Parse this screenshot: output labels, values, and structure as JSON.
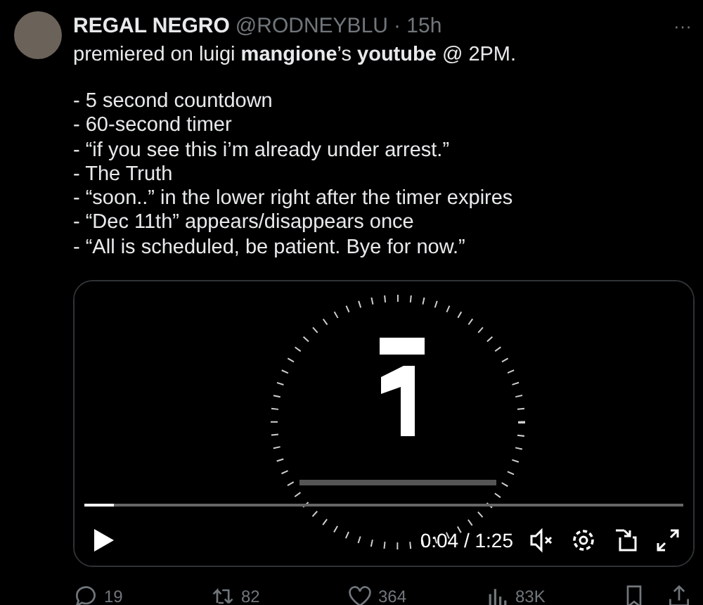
{
  "author": {
    "name": "REGAL NEGRO",
    "handle": "@RODNEYBLU",
    "time": "· 15h",
    "more": "···"
  },
  "text": {
    "lead": "premiered on luigi **mangione**’s **youtube** @ 2PM.",
    "list": [
      "- 5 second countdown",
      "- 60-second timer",
      "- “if you see this i’m already under arrest.”",
      "- The Truth",
      "- “soon..” in the lower right after the timer expires",
      "- “Dec 11th” appears/disappears once",
      "- “All is scheduled, be patient. Bye for now.”"
    ]
  },
  "video": {
    "kind": "picture",
    "progress": {
      "level": 0.05
    },
    "time": "0:04 / 1:25",
    "muted": true
  },
  "actions": [
    {
      "kind": "reply",
      "count": "19"
    },
    {
      "kind": "repost",
      "count": "82"
    },
    {
      "kind": "like",
      "count": "364"
    },
    {
      "kind": "views",
      "count": "83K"
    }
  ]
}
